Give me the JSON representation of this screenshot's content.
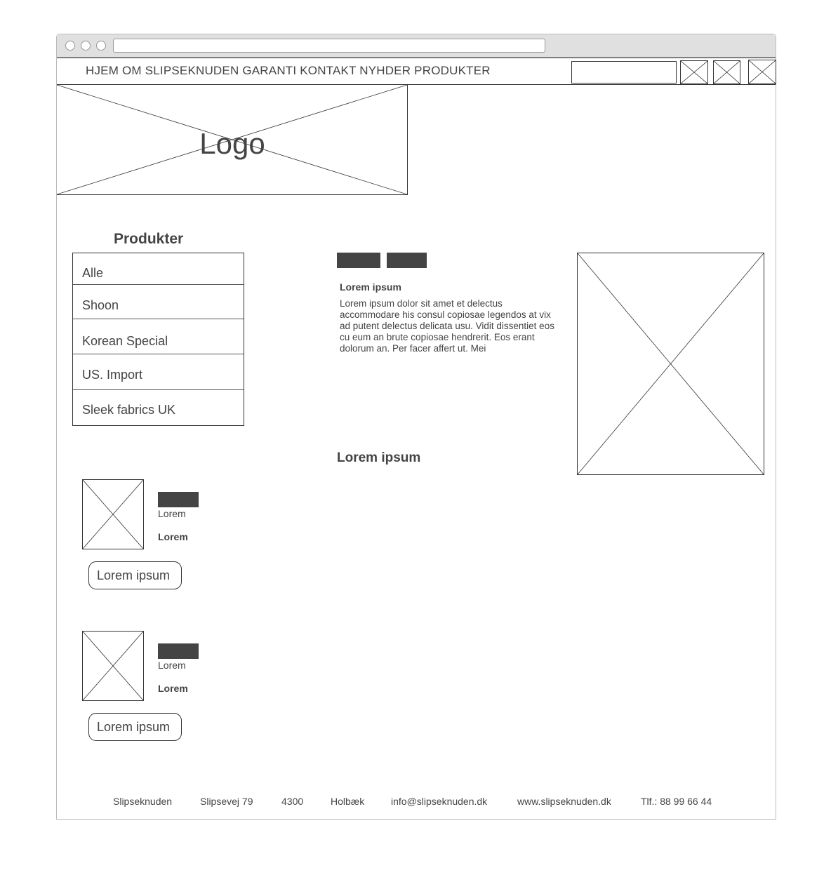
{
  "nav": {
    "menu_text": "HJEM OM SLIPSEKNUDEN GARANTI KONTAKT NYHDER PRODUKTER",
    "search_placeholder": ""
  },
  "logo": {
    "text": "Logo"
  },
  "sidebar": {
    "heading": "Produkter",
    "items": [
      {
        "label": "Alle"
      },
      {
        "label": "Shoon"
      },
      {
        "label": "Korean Special"
      },
      {
        "label": "US. Import"
      },
      {
        "label": "Sleek fabrics UK"
      }
    ]
  },
  "content": {
    "title": "Lorem ipsum",
    "body": "Lorem ipsum dolor sit amet et delectus accommodare his consul copiosae legendos at vix ad putent delectus delicata usu. Vidit dissentiet eos cu eum an brute copiosae hendrerit. Eos erant dolorum an. Per facer affert ut. Mei"
  },
  "section": {
    "title": "Lorem ipsum"
  },
  "products": [
    {
      "text": "Lorem",
      "bold": "Lorem",
      "button": "Lorem ipsum"
    },
    {
      "text": "Lorem",
      "bold": "Lorem",
      "button": "Lorem ipsum"
    }
  ],
  "footer": {
    "company": "Slipseknuden",
    "street": "Slipsevej 79",
    "zip": "4300",
    "city": "Holbæk",
    "email": "info@slipseknuden.dk",
    "website": "www.slipseknuden.dk",
    "phone": "Tlf.: 88 99 66 44"
  },
  "colors": {
    "ink": "#444444",
    "border": "#333333",
    "chrome": "#e0e0e0"
  }
}
